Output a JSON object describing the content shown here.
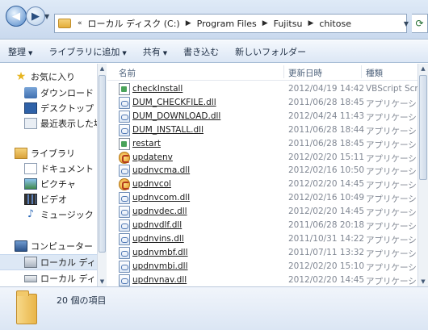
{
  "address": {
    "crumbs": [
      "ローカル ディスク (C:)",
      "Program Files",
      "Fujitsu",
      "chitose"
    ],
    "overflow": "«"
  },
  "toolbar": {
    "organize": "整理",
    "add_to_library": "ライブラリに追加",
    "share": "共有",
    "burn": "書き込む",
    "new_folder": "新しいフォルダー"
  },
  "sidebar": {
    "favorites": "お気に入り",
    "downloads": "ダウンロード",
    "desktop": "デスクトップ",
    "recent": "最近表示した場所",
    "libraries": "ライブラリ",
    "documents": "ドキュメント",
    "pictures": "ピクチャ",
    "videos": "ビデオ",
    "music": "ミュージック",
    "computer": "コンピューター",
    "local_disk_1": "ローカル ディスク",
    "local_disk_2": "ローカル ディスク"
  },
  "columns": {
    "name": "名前",
    "date": "更新日時",
    "type": "種類"
  },
  "files": [
    {
      "name": "checkInstall",
      "date": "2012/04/19 14:42",
      "type": "VBScript Script ...",
      "icon": "script"
    },
    {
      "name": "DUM_CHECKFILE.dll",
      "date": "2011/06/28 18:45",
      "type": "アプリケーション...",
      "icon": "dll"
    },
    {
      "name": "DUM_DOWNLOAD.dll",
      "date": "2012/04/24 11:43",
      "type": "アプリケーション...",
      "icon": "dll"
    },
    {
      "name": "DUM_INSTALL.dll",
      "date": "2011/06/28 18:44",
      "type": "アプリケーション...",
      "icon": "dll"
    },
    {
      "name": "restart",
      "date": "2011/06/28 18:45",
      "type": "アプリケーション...",
      "icon": "script"
    },
    {
      "name": "updatenv",
      "date": "2012/02/20 15:11",
      "type": "アプリケーション...",
      "icon": "exe"
    },
    {
      "name": "updnvcma.dll",
      "date": "2012/02/16 10:50",
      "type": "アプリケーション...",
      "icon": "dll"
    },
    {
      "name": "updnvcol",
      "date": "2012/02/20 14:45",
      "type": "アプリケーション...",
      "icon": "exe"
    },
    {
      "name": "updnvcom.dll",
      "date": "2012/02/16 10:49",
      "type": "アプリケーション...",
      "icon": "dll"
    },
    {
      "name": "updnvdec.dll",
      "date": "2012/02/20 14:45",
      "type": "アプリケーション...",
      "icon": "dll"
    },
    {
      "name": "updnvdlf.dll",
      "date": "2011/06/28 20:18",
      "type": "アプリケーション...",
      "icon": "dll"
    },
    {
      "name": "updnvins.dll",
      "date": "2011/10/31 14:22",
      "type": "アプリケーション...",
      "icon": "dll"
    },
    {
      "name": "updnvmbf.dll",
      "date": "2011/07/11 13:32",
      "type": "アプリケーション...",
      "icon": "dll"
    },
    {
      "name": "updnvmbi.dll",
      "date": "2012/02/20 15:10",
      "type": "アプリケーション...",
      "icon": "dll"
    },
    {
      "name": "updnvnav.dll",
      "date": "2012/02/20 14:45",
      "type": "アプリケーション...",
      "icon": "dll"
    }
  ],
  "status": {
    "item_count": "20 個の項目"
  }
}
